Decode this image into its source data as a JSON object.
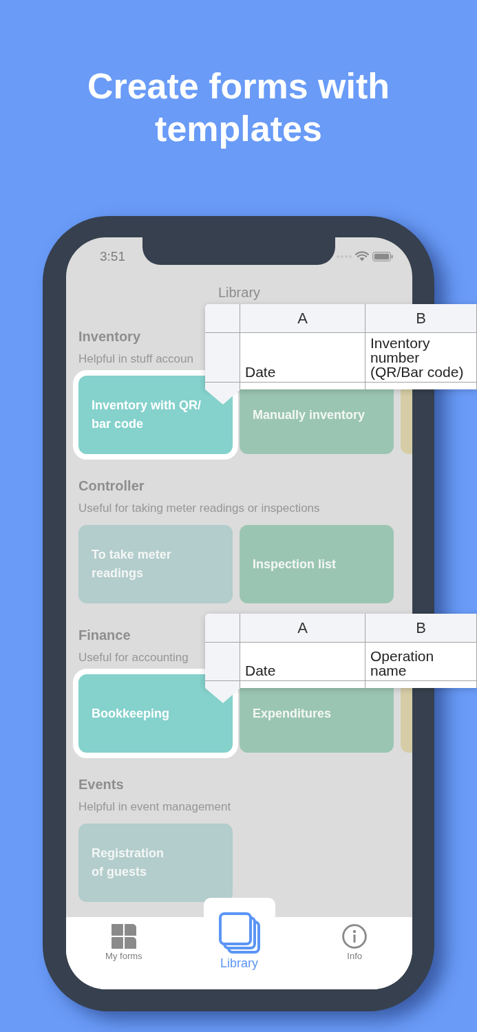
{
  "headline": "Create forms with templates",
  "status_bar": {
    "time": "3:51"
  },
  "screen_title": "Library",
  "sections": [
    {
      "title": "Inventory",
      "subtitle": "Helpful in stuff accoun",
      "templates": [
        {
          "title": "Inventory with QR/\nbar code",
          "color": "#85d1cc",
          "highlighted": true
        },
        {
          "title": "Manually inventory",
          "color": "#9bc5b3",
          "highlighted": false
        },
        {
          "color": "#d6cda6",
          "highlighted": false
        }
      ],
      "preview": {
        "columns": [
          "A",
          "B"
        ],
        "rows": [
          [
            "Date",
            "Inventory number (QR/Bar code)"
          ]
        ]
      }
    },
    {
      "title": "Controller",
      "subtitle": "Useful for taking meter readings or inspections",
      "templates": [
        {
          "title": "To take meter\nreadings",
          "color": "#b3cccc",
          "highlighted": false
        },
        {
          "title": "Inspection list",
          "color": "#9bc5b3",
          "highlighted": false
        }
      ]
    },
    {
      "title": "Finance",
      "subtitle": "Useful for accounting",
      "templates": [
        {
          "title": "Bookkeeping",
          "color": "#85d1cc",
          "highlighted": true
        },
        {
          "title": "Expenditures",
          "color": "#9bc5b3",
          "highlighted": false
        },
        {
          "color": "#d6cda6",
          "highlighted": false
        }
      ],
      "preview": {
        "columns": [
          "A",
          "B"
        ],
        "rows": [
          [
            "Date",
            "Operation name"
          ]
        ]
      }
    },
    {
      "title": "Events",
      "subtitle": "Helpful in event management",
      "templates": [
        {
          "title": "Registration\nof guests",
          "color": "#b3cccc",
          "highlighted": false
        }
      ]
    }
  ],
  "tab_bar": {
    "tabs": [
      {
        "label": "My forms",
        "selected": false
      },
      {
        "label": "Library",
        "selected": true
      },
      {
        "label": "Info",
        "selected": false
      }
    ]
  }
}
